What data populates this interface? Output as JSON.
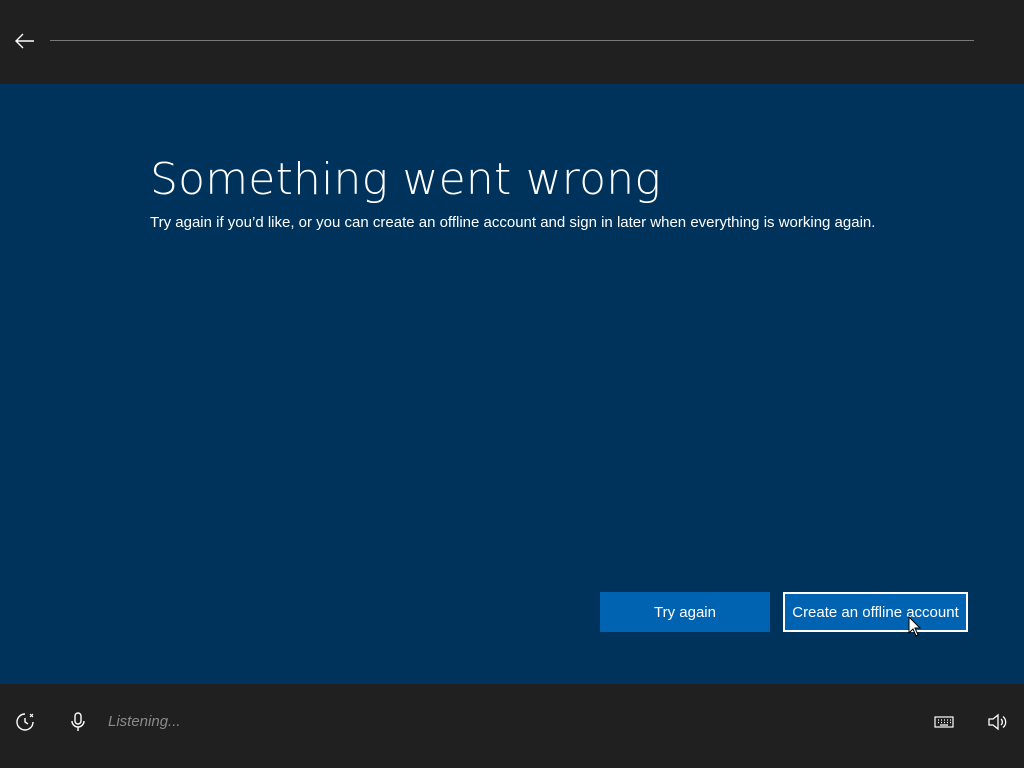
{
  "header": {
    "back_icon": "arrow-left-icon"
  },
  "main": {
    "title": "Something went wrong",
    "subtitle": "Try again if you’d like, or you can create an offline account and sign in later when everything is working again.",
    "try_again_label": "Try again",
    "offline_account_label": "Create an offline account",
    "background_color": "#00335c",
    "button_color": "#0063b1"
  },
  "footer": {
    "ease_of_access_icon": "ease-of-access-icon",
    "microphone_icon": "microphone-icon",
    "listening_text": "Listening...",
    "keyboard_icon": "keyboard-icon",
    "volume_icon": "volume-icon"
  }
}
